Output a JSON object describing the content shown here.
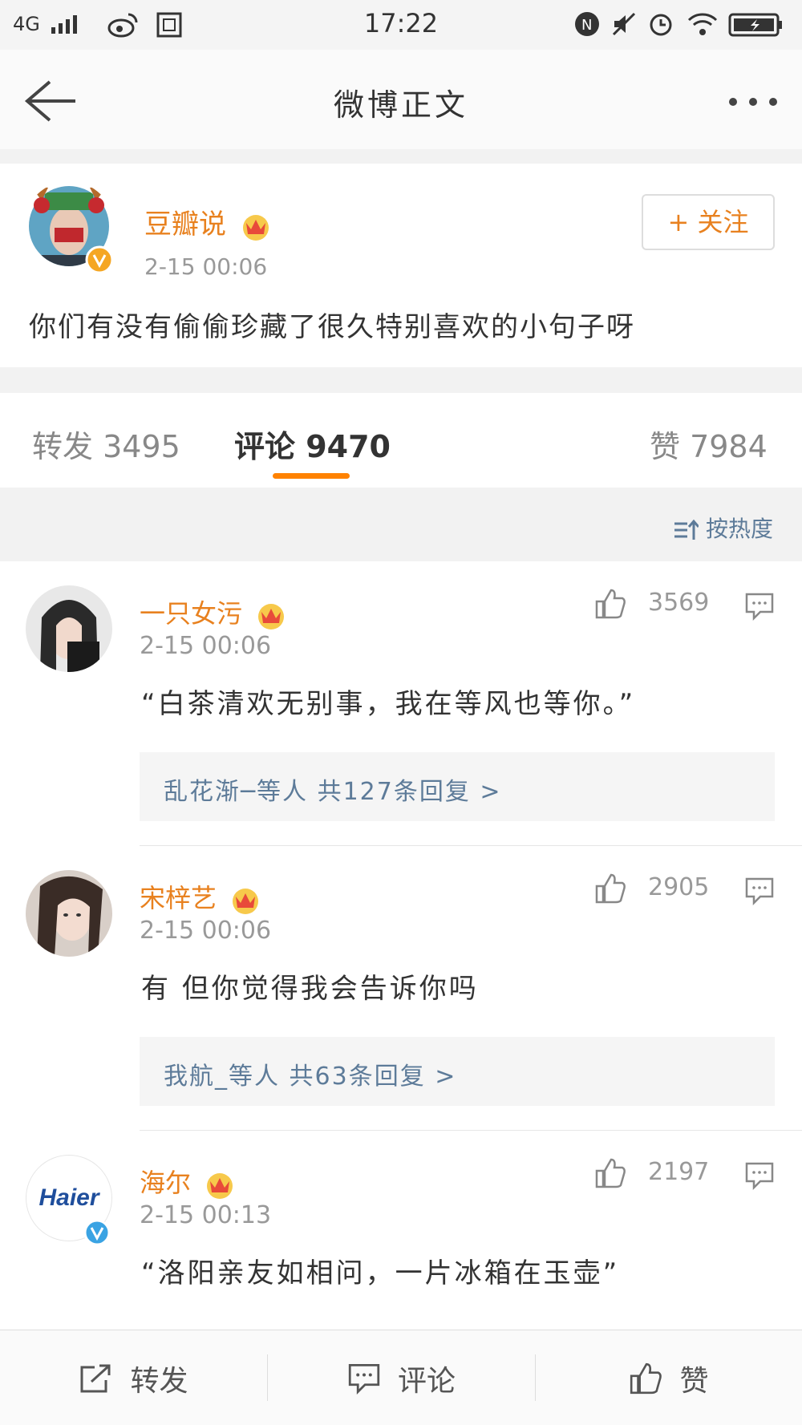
{
  "status_bar": {
    "signal": "4G",
    "time": "17:22"
  },
  "nav": {
    "title": "微博正文"
  },
  "post": {
    "author": "豆瓣说",
    "time": "2-15 00:06",
    "content": "你们有没有偷偷珍藏了很久特别喜欢的小句子呀",
    "follow_label": "+ 关注"
  },
  "tabs": {
    "repost": "转发 3495",
    "comments": "评论 9470",
    "likes": "赞 7984"
  },
  "sort_label": "按热度",
  "comments": [
    {
      "name": "一只女污",
      "time": "2-15 00:06",
      "likes": "3569",
      "text": "“白茶清欢无别事，我在等风也等你。”",
      "replies": "乱花渐─等人  共127条回复  >"
    },
    {
      "name": "宋梓艺",
      "time": "2-15 00:06",
      "likes": "2905",
      "text": "有 但你觉得我会告诉你吗",
      "replies": "我航_等人  共63条回复  >"
    },
    {
      "name": "海尔",
      "time": "2-15 00:13",
      "likes": "2197",
      "text": "“洛阳亲友如相问，一片冰箱在玉壶”",
      "avatar_text": "Haier"
    }
  ],
  "bottom_bar": {
    "repost": "转发",
    "comment": "评论",
    "like": "赞"
  },
  "colors": {
    "accent": "#e8811f",
    "indicator": "#ff8200",
    "link": "#5d7b99"
  },
  "icons": [
    "back-arrow-icon",
    "more-icon",
    "thumbs-up-icon",
    "comment-bubble-icon",
    "share-icon",
    "crown-icon",
    "verified-icon",
    "sort-icon"
  ]
}
